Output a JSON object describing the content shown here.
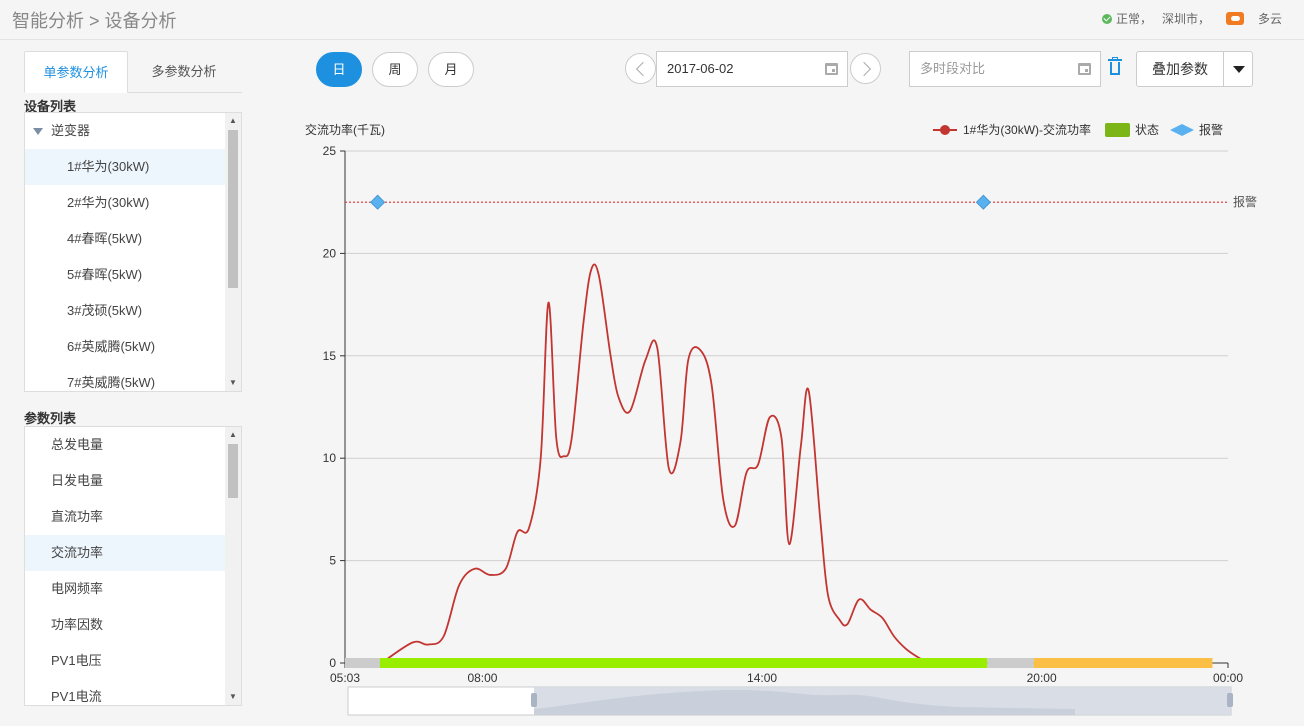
{
  "header": {
    "breadcrumb": [
      "智能分析",
      "设备分析"
    ],
    "separator": ">",
    "status": "正常，",
    "city": "深圳市，",
    "weather": "多云",
    "weather_icon": "cloud-sun-icon",
    "status_icon": "check-circle-icon"
  },
  "tabs": [
    {
      "label": "单参数分析",
      "active": true
    },
    {
      "label": "多参数分析",
      "active": false
    }
  ],
  "device_list": {
    "title": "设备列表",
    "group": "逆变器",
    "items": [
      "1#华为(30kW)",
      "2#华为(30kW)",
      "4#春晖(5kW)",
      "5#春晖(5kW)",
      "3#茂硕(5kW)",
      "6#英威腾(5kW)",
      "7#英威腾(5kW)"
    ],
    "selected_index": 0
  },
  "param_list": {
    "title": "参数列表",
    "items": [
      "总发电量",
      "日发电量",
      "直流功率",
      "交流功率",
      "电网频率",
      "功率因数",
      "PV1电压",
      "PV1电流"
    ],
    "selected_index": 3
  },
  "controls": {
    "periods": [
      {
        "label": "日",
        "active": true
      },
      {
        "label": "周",
        "active": false
      },
      {
        "label": "月",
        "active": false
      }
    ],
    "date": "2017-06-02",
    "compare_placeholder": "多时段对比",
    "overlay_label": "叠加参数",
    "colors": {
      "accent": "#1e90e0"
    }
  },
  "chart_data": {
    "type": "line",
    "ylabel": "交流功率(千瓦)",
    "ylim": [
      0,
      25
    ],
    "yticks": [
      0,
      5,
      10,
      15,
      20,
      25
    ],
    "x_range": [
      "05:03",
      "00:00"
    ],
    "xticks": [
      "05:03",
      "08:00",
      "14:00",
      "20:00",
      "00:00"
    ],
    "legend_position": "top-right",
    "legend": [
      {
        "label": "1#华为(30kW)-交流功率",
        "color": "#c23531",
        "shape": "line-dot"
      },
      {
        "label": "状态",
        "color": "#7cb518",
        "shape": "rect"
      },
      {
        "label": "报警",
        "color": "#5ab1ef",
        "shape": "diamond"
      }
    ],
    "alarm_line": {
      "value": 22.5,
      "label": "报警",
      "color": "#e03030"
    },
    "alarm_markers": [
      "05:45",
      "18:45"
    ],
    "series": [
      {
        "name": "1#华为(30kW)-交流功率",
        "color": "#c23531",
        "x": [
          "05:50",
          "06:30",
          "06:50",
          "07:10",
          "07:30",
          "07:50",
          "08:10",
          "08:30",
          "08:45",
          "09:00",
          "09:15",
          "09:25",
          "09:35",
          "09:45",
          "09:55",
          "10:10",
          "10:20",
          "10:30",
          "10:45",
          "10:55",
          "11:10",
          "11:30",
          "11:45",
          "12:00",
          "12:15",
          "12:25",
          "12:40",
          "12:55",
          "13:10",
          "13:25",
          "13:40",
          "13:55",
          "14:10",
          "14:25",
          "14:35",
          "14:50",
          "15:00",
          "15:15",
          "15:25",
          "15:40",
          "15:50",
          "16:05",
          "16:20",
          "16:35",
          "16:50",
          "17:05",
          "17:20",
          "17:35",
          "17:50",
          "18:05",
          "18:20",
          "18:40"
        ],
        "values": [
          0,
          1,
          0.9,
          1.3,
          3.8,
          4.6,
          4.3,
          4.6,
          6.4,
          6.6,
          10,
          17.6,
          11,
          10.1,
          11,
          16.6,
          19.2,
          18.9,
          15,
          13,
          12.3,
          14.8,
          15.4,
          9.5,
          10.8,
          14.8,
          15.3,
          13.6,
          8.0,
          6.7,
          9.3,
          9.7,
          12,
          11,
          5.8,
          10.6,
          13.3,
          7,
          3.3,
          2.1,
          1.9,
          3.1,
          2.6,
          2.2,
          1.3,
          0.7,
          0.3,
          0,
          0,
          0,
          0,
          0
        ]
      }
    ],
    "status_bar": [
      {
        "from": "05:03",
        "to": "05:48",
        "color": "#cccccc"
      },
      {
        "from": "05:48",
        "to": "18:50",
        "color": "#99ee00"
      },
      {
        "from": "18:50",
        "to": "19:50",
        "color": "#cccccc"
      },
      {
        "from": "19:50",
        "to": "23:40",
        "color": "#fbbf45"
      }
    ]
  }
}
